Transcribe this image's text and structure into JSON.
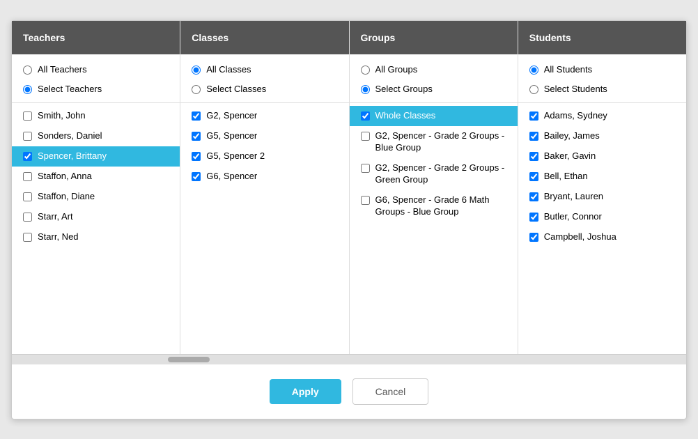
{
  "columns": {
    "teachers": {
      "header": "Teachers",
      "radio_all": "All Teachers",
      "radio_select": "Select Teachers",
      "items": [
        {
          "label": "Smith, John",
          "checked": false
        },
        {
          "label": "Sonders, Daniel",
          "checked": false
        },
        {
          "label": "Spencer, Brittany",
          "checked": true,
          "selected": true
        },
        {
          "label": "Staffon, Anna",
          "checked": false
        },
        {
          "label": "Staffon, Diane",
          "checked": false
        },
        {
          "label": "Starr, Art",
          "checked": false
        },
        {
          "label": "Starr, Ned",
          "checked": false
        }
      ]
    },
    "classes": {
      "header": "Classes",
      "radio_all": "All Classes",
      "radio_select": "Select Classes",
      "items": [
        {
          "label": "G2, Spencer",
          "checked": true
        },
        {
          "label": "G5, Spencer",
          "checked": true
        },
        {
          "label": "G5, Spencer 2",
          "checked": true
        },
        {
          "label": "G6, Spencer",
          "checked": true
        }
      ]
    },
    "groups": {
      "header": "Groups",
      "radio_all": "All Groups",
      "radio_select": "Select Groups",
      "items": [
        {
          "label": "Whole Classes",
          "checked": true,
          "selected": true
        },
        {
          "label": "G2, Spencer - Grade 2 Groups - Blue Group",
          "checked": false
        },
        {
          "label": "G2, Spencer - Grade 2 Groups - Green Group",
          "checked": false
        },
        {
          "label": "G6, Spencer - Grade 6 Math Groups - Blue Group",
          "checked": false
        }
      ]
    },
    "students": {
      "header": "Students",
      "radio_all": "All Students",
      "radio_select": "Select Students",
      "items": [
        {
          "label": "Adams, Sydney",
          "checked": true
        },
        {
          "label": "Bailey, James",
          "checked": true
        },
        {
          "label": "Baker, Gavin",
          "checked": true
        },
        {
          "label": "Bell, Ethan",
          "checked": true
        },
        {
          "label": "Bryant, Lauren",
          "checked": true
        },
        {
          "label": "Butler, Connor",
          "checked": true
        },
        {
          "label": "Campbell, Joshua",
          "checked": true
        }
      ]
    }
  },
  "footer": {
    "apply_label": "Apply",
    "cancel_label": "Cancel"
  },
  "radio_state": {
    "teachers": "select",
    "classes": "all",
    "groups": "select",
    "students": "all"
  }
}
